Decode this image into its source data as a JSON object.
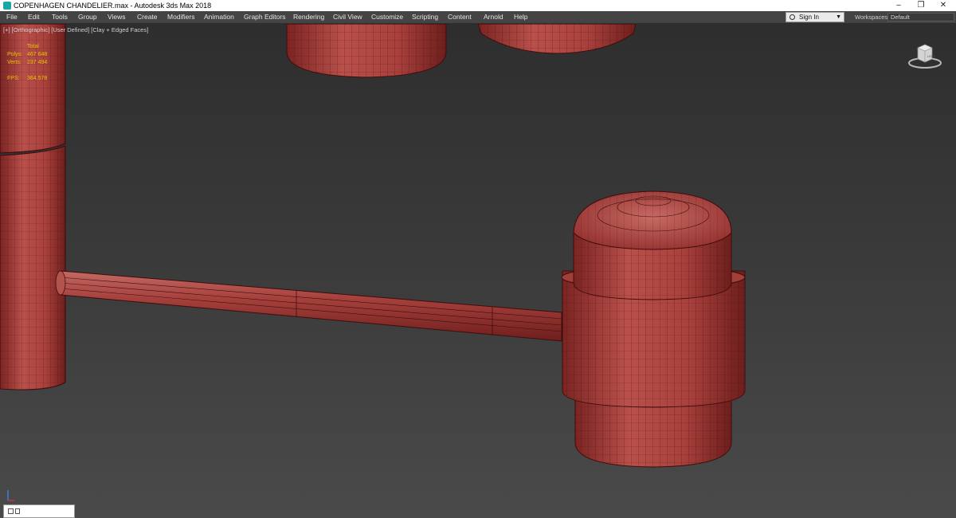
{
  "window": {
    "title": "COPENHAGEN CHANDELIER.max - Autodesk 3ds Max 2018",
    "minimize": "–",
    "restore": "❐",
    "close": "✕"
  },
  "menu": {
    "items": [
      "File",
      "Edit",
      "Tools",
      "Group",
      "Views",
      "Create",
      "Modifiers",
      "Animation",
      "Graph Editors",
      "Rendering",
      "Civil View",
      "Customize",
      "Scripting",
      "Content",
      "Arnold",
      "Help"
    ],
    "sign_in": "Sign In",
    "workspaces_label": "Workspaces:",
    "workspace_value": "Default"
  },
  "viewport": {
    "label": "[+] [Orthographic] [User Defined] [Clay + Edged Faces]",
    "stats": {
      "header": "Total",
      "polys_label": "Polys:",
      "polys_value": "467 648",
      "verts_label": "Verts:",
      "verts_value": "237 494",
      "fps_label": "FPS:",
      "fps_value": "364,578"
    },
    "viewcube_label": "LEFT"
  },
  "colors": {
    "clay": "#b0413e",
    "clay_dark": "#7a2220",
    "wire": "#3e0d0b",
    "stats_text": "#e6c200"
  },
  "icons": [
    "app-icon",
    "user-icon",
    "viewcube-icon",
    "axis-tripod-icon",
    "maxscript-icon"
  ]
}
